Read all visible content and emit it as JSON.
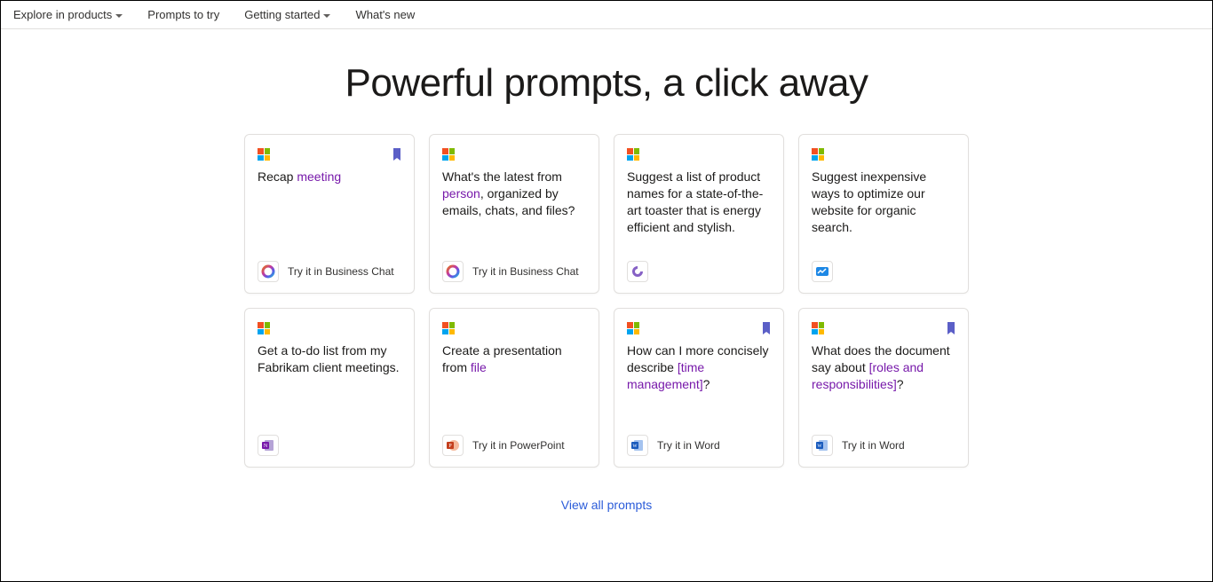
{
  "nav": {
    "explore": "Explore in products",
    "prompts": "Prompts to try",
    "getting_started": "Getting started",
    "whats_new": "What's new"
  },
  "hero": "Powerful prompts, a click away",
  "cards": [
    {
      "segments": [
        {
          "t": "Recap "
        },
        {
          "t": "meeting",
          "v": true
        }
      ],
      "bookmarked": true,
      "try_label": "Try it in Business Chat",
      "app": "businesschat"
    },
    {
      "segments": [
        {
          "t": "What's the latest from "
        },
        {
          "t": "person",
          "v": true
        },
        {
          "t": ", organized by emails, chats, and files?"
        }
      ],
      "bookmarked": false,
      "try_label": "Try it in Business Chat",
      "app": "businesschat"
    },
    {
      "segments": [
        {
          "t": "Suggest a list of product names for a state-of-the-art toaster that is energy efficient and stylish."
        }
      ],
      "bookmarked": false,
      "try_label": "",
      "app": "loop"
    },
    {
      "segments": [
        {
          "t": "Suggest inexpensive ways to optimize our website for organic search."
        }
      ],
      "bookmarked": false,
      "try_label": "",
      "app": "whiteboard"
    },
    {
      "segments": [
        {
          "t": "Get a to-do list from my Fabrikam client meetings."
        }
      ],
      "bookmarked": false,
      "try_label": "",
      "app": "onenote"
    },
    {
      "segments": [
        {
          "t": "Create a presentation from "
        },
        {
          "t": "file",
          "v": true
        }
      ],
      "bookmarked": false,
      "try_label": "Try it in PowerPoint",
      "app": "powerpoint"
    },
    {
      "segments": [
        {
          "t": "How can I more concisely describe "
        },
        {
          "t": "[time management]",
          "v": true
        },
        {
          "t": "?"
        }
      ],
      "bookmarked": true,
      "try_label": "Try it in Word",
      "app": "word"
    },
    {
      "segments": [
        {
          "t": "What does the document say about "
        },
        {
          "t": "[roles and responsibilities]",
          "v": true
        },
        {
          "t": "?"
        }
      ],
      "bookmarked": true,
      "try_label": "Try it in Word",
      "app": "word"
    }
  ],
  "view_all": "View all prompts",
  "app_icons": {
    "businesschat": "businesschat",
    "loop": "loop",
    "whiteboard": "whiteboard",
    "onenote": "onenote",
    "powerpoint": "powerpoint",
    "word": "word"
  }
}
